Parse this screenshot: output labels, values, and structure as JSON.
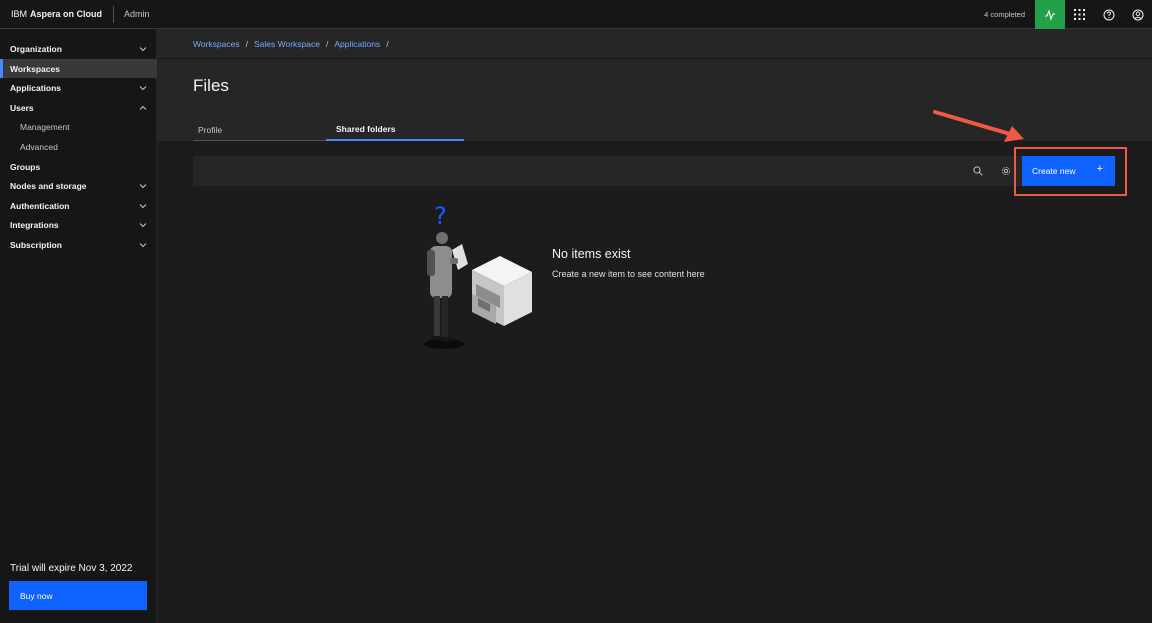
{
  "header": {
    "brand_ibm": "IBM",
    "brand_product": "Aspera on Cloud",
    "context": "Admin",
    "completed": "4 completed",
    "activity_color": "#24a148"
  },
  "sidebar": {
    "items": [
      {
        "label": "Organization",
        "expandable": true
      },
      {
        "label": "Workspaces",
        "active": true
      },
      {
        "label": "Applications",
        "expandable": true
      },
      {
        "label": "Users",
        "expanded": true
      },
      {
        "label": "Management",
        "sub": true
      },
      {
        "label": "Advanced",
        "sub": true
      },
      {
        "label": "Groups"
      },
      {
        "label": "Nodes and storage",
        "expandable": true
      },
      {
        "label": "Authentication",
        "expandable": true
      },
      {
        "label": "Integrations",
        "expandable": true
      },
      {
        "label": "Subscription",
        "expandable": true
      }
    ],
    "trial": "Trial will expire Nov 3, 2022",
    "buy_label": "Buy now"
  },
  "breadcrumb": [
    "Workspaces",
    "Sales Workspace",
    "Applications"
  ],
  "page": {
    "title": "Files",
    "tabs": [
      {
        "label": "Profile",
        "selected": false
      },
      {
        "label": "Shared folders",
        "selected": true
      }
    ]
  },
  "toolbar": {
    "create_label": "Create new",
    "create_icon": "+"
  },
  "empty_state": {
    "title": "No items exist",
    "subtitle": "Create a new item to see content here",
    "question_mark": "?"
  },
  "colors": {
    "accent": "#0f62fe",
    "link": "#78a9ff",
    "annotation": "#ef5a47"
  }
}
